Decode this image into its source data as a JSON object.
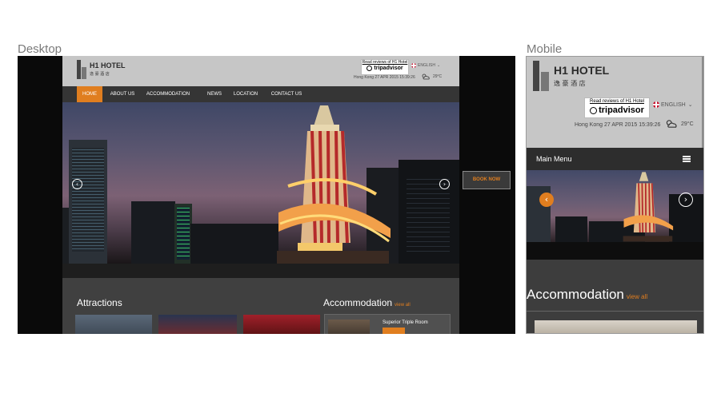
{
  "labels": {
    "desktop": "Desktop",
    "mobile": "Mobile"
  },
  "brand": {
    "name": "H1 HOTEL",
    "chinese": "逸 豪 酒 店"
  },
  "tripadvisor": {
    "review_text": "Read reviews of H1 Hotel",
    "name": "tripadvisor"
  },
  "language": {
    "label": "ENGLISH",
    "flag_icon": "uk-flag-icon",
    "arrow_icon": "chevron-down-icon"
  },
  "datetime": {
    "city": "Hong Kong",
    "date": "27 APR 2015",
    "time": "15:39:26"
  },
  "weather": {
    "temp": "29°C",
    "icon": "partly-cloudy-icon"
  },
  "nav": {
    "items": [
      {
        "label": "HOME",
        "active": true
      },
      {
        "label": "ABOUT US"
      },
      {
        "label": "ACCOMMODATION"
      },
      {
        "label": "NEWS"
      },
      {
        "label": "LOCATION"
      },
      {
        "label": "CONTACT US"
      }
    ]
  },
  "book_now": "BOOK NOW",
  "slider": {
    "prev_icon": "chevron-left-icon",
    "next_icon": "chevron-right-icon"
  },
  "sections": {
    "attractions": "Attractions",
    "accommodation": "Accommodation",
    "view_all": "view all",
    "room_title": "Superior Triple Room"
  },
  "mobile": {
    "menu_label": "Main Menu",
    "menu_icon": "hamburger-icon"
  },
  "colors": {
    "accent": "#e07e1f",
    "header_bg": "#c6c6c6",
    "nav_bg": "#353535"
  }
}
